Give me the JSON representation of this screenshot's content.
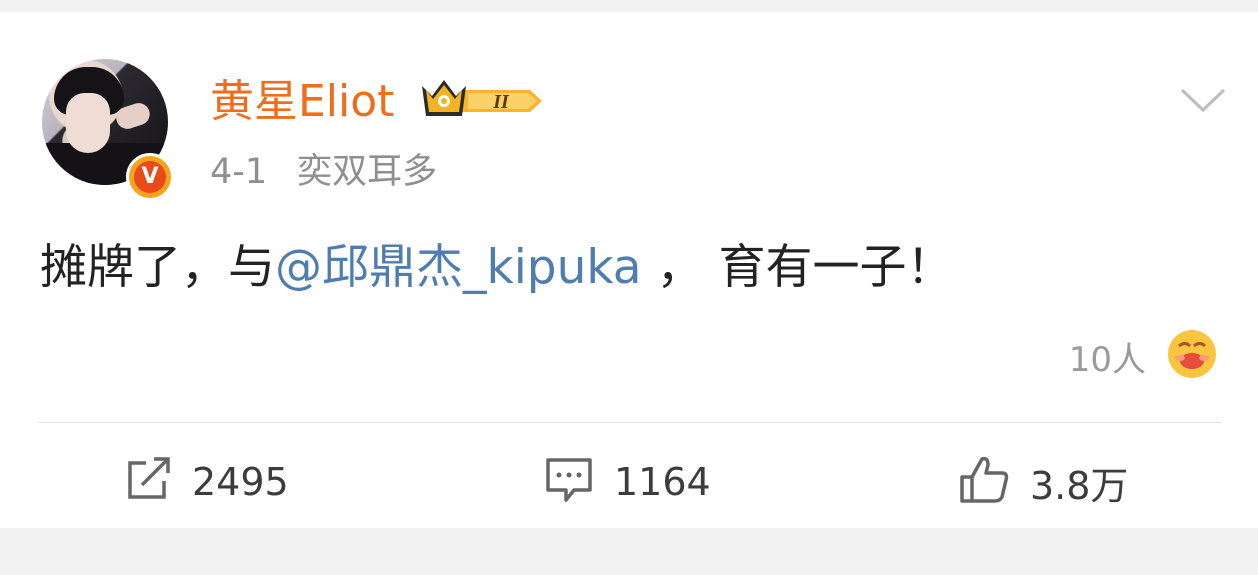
{
  "post": {
    "author": "黄星Eliot",
    "member_level": "II",
    "verified_badge": "V",
    "time": "4-1",
    "source": "奕双耳多",
    "text_before": "摊牌了，与",
    "mention": "@邱鼎杰_kipuka",
    "text_after": " ， 育有一子！",
    "reaction_count": "10人"
  },
  "actions": {
    "repost_count": "2495",
    "comment_count": "1164",
    "like_count": "3.8万"
  },
  "colors": {
    "author": "#f06e1b",
    "mention": "#507daf",
    "meta": "#8f8f8f"
  },
  "icons": [
    "chevron-down-icon",
    "crown-badge-icon",
    "verified-v-icon",
    "reaction-emoji-icon",
    "repost-icon",
    "comment-icon",
    "like-icon"
  ]
}
